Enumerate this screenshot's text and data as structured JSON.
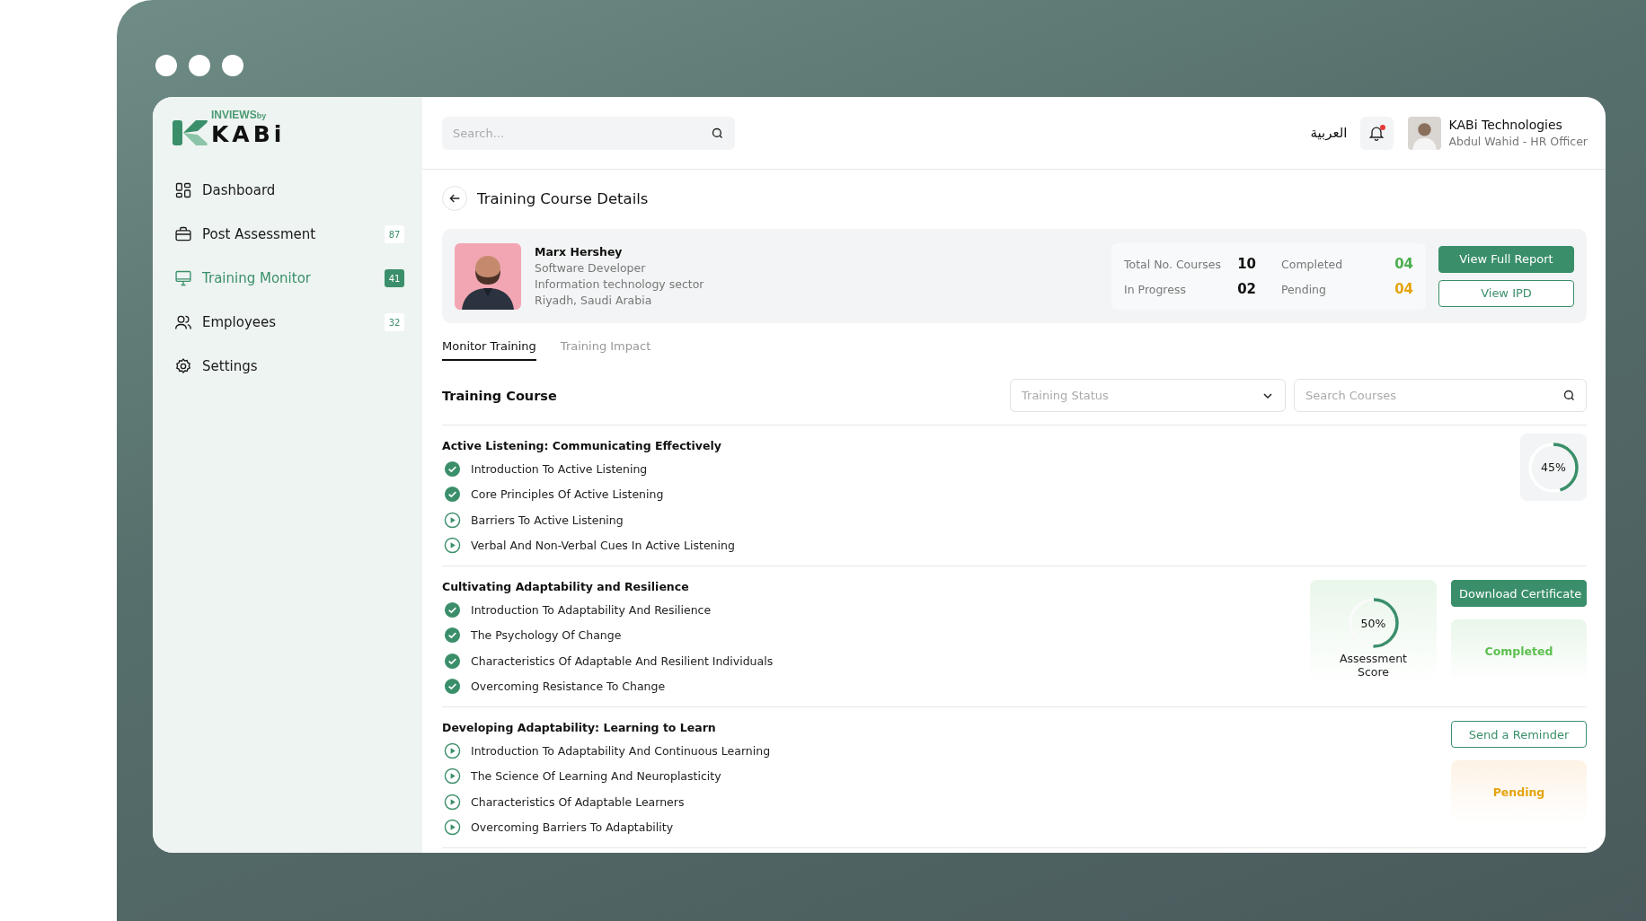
{
  "logo": {
    "brand": "INVIEWS",
    "by": "by",
    "name": "KABi"
  },
  "sidebar": {
    "items": [
      {
        "label": "Dashboard",
        "selected": false
      },
      {
        "label": "Post Assessment",
        "badge": "87",
        "selected": false
      },
      {
        "label": "Training Monitor",
        "badge": "41",
        "selected": true
      },
      {
        "label": "Employees",
        "badge": "32",
        "selected": false
      },
      {
        "label": "Settings",
        "selected": false
      }
    ]
  },
  "header": {
    "search": {
      "placeholder": "Search..."
    },
    "language": "العربية",
    "notification_unread": true,
    "company": "KABi Technologies",
    "user": "Abdul Wahid - HR Officer"
  },
  "page_title": "Training Course Details",
  "employee": {
    "name": "Marx Hershey",
    "role": "Software Developer",
    "sector": "Information technology sector",
    "location": "Riyadh, Saudi Arabia",
    "stats": [
      {
        "label": "Total No. Courses",
        "value": "10",
        "color": "#111111"
      },
      {
        "label": "Completed",
        "value": "04",
        "color": "#4caf50"
      },
      {
        "label": "In Progress",
        "value": "02",
        "color": "#111111"
      },
      {
        "label": "Pending",
        "value": "04",
        "color": "#e5a40f"
      }
    ],
    "buttons": [
      {
        "label": "View Full Report",
        "kind": "primary"
      },
      {
        "label": "View IPD",
        "kind": "outline"
      }
    ]
  },
  "tabs": [
    {
      "label": "Monitor Training",
      "selected": true
    },
    {
      "label": "Training Impact",
      "selected": false
    }
  ],
  "course_section": {
    "title": "Training Course",
    "status_filter": {
      "placeholder": "Training Status"
    },
    "search": {
      "placeholder": "Search Courses"
    }
  },
  "courses": [
    {
      "title": "Active Listening: Communicating Effectively",
      "progress": {
        "text": "45%",
        "level": 0.45
      },
      "lessons": [
        {
          "title": "Introduction To Active Listening",
          "completed": true
        },
        {
          "title": "Core Principles Of Active Listening",
          "completed": true
        },
        {
          "title": "Barriers To Active Listening",
          "completed": false
        },
        {
          "title": "Verbal And Non-Verbal Cues In Active Listening",
          "completed": false
        }
      ]
    },
    {
      "title": "Cultivating Adaptability and Resilience",
      "assessment": {
        "text": "50%",
        "level": 0.5,
        "label": "Assessment Score"
      },
      "action": {
        "label": "Download Certificate",
        "kind": "primary"
      },
      "status": {
        "label": "Completed",
        "kind": "completed"
      },
      "lessons": [
        {
          "title": "Introduction To Adaptability And Resilience",
          "completed": true
        },
        {
          "title": "The Psychology Of Change",
          "completed": true
        },
        {
          "title": "Characteristics Of Adaptable And Resilient Individuals",
          "completed": true
        },
        {
          "title": "Overcoming Resistance To Change",
          "completed": true
        }
      ]
    },
    {
      "title": "Developing Adaptability: Learning to Learn",
      "action": {
        "label": "Send a Reminder",
        "kind": "outline"
      },
      "status": {
        "label": "Pending",
        "kind": "pending"
      },
      "lessons": [
        {
          "title": "Introduction To Adaptability And Continuous Learning",
          "completed": false
        },
        {
          "title": "The Science Of Learning And Neuroplasticity",
          "completed": false
        },
        {
          "title": "Characteristics Of Adaptable Learners",
          "completed": false
        },
        {
          "title": "Overcoming Barriers To Adaptability",
          "completed": false
        }
      ]
    }
  ]
}
